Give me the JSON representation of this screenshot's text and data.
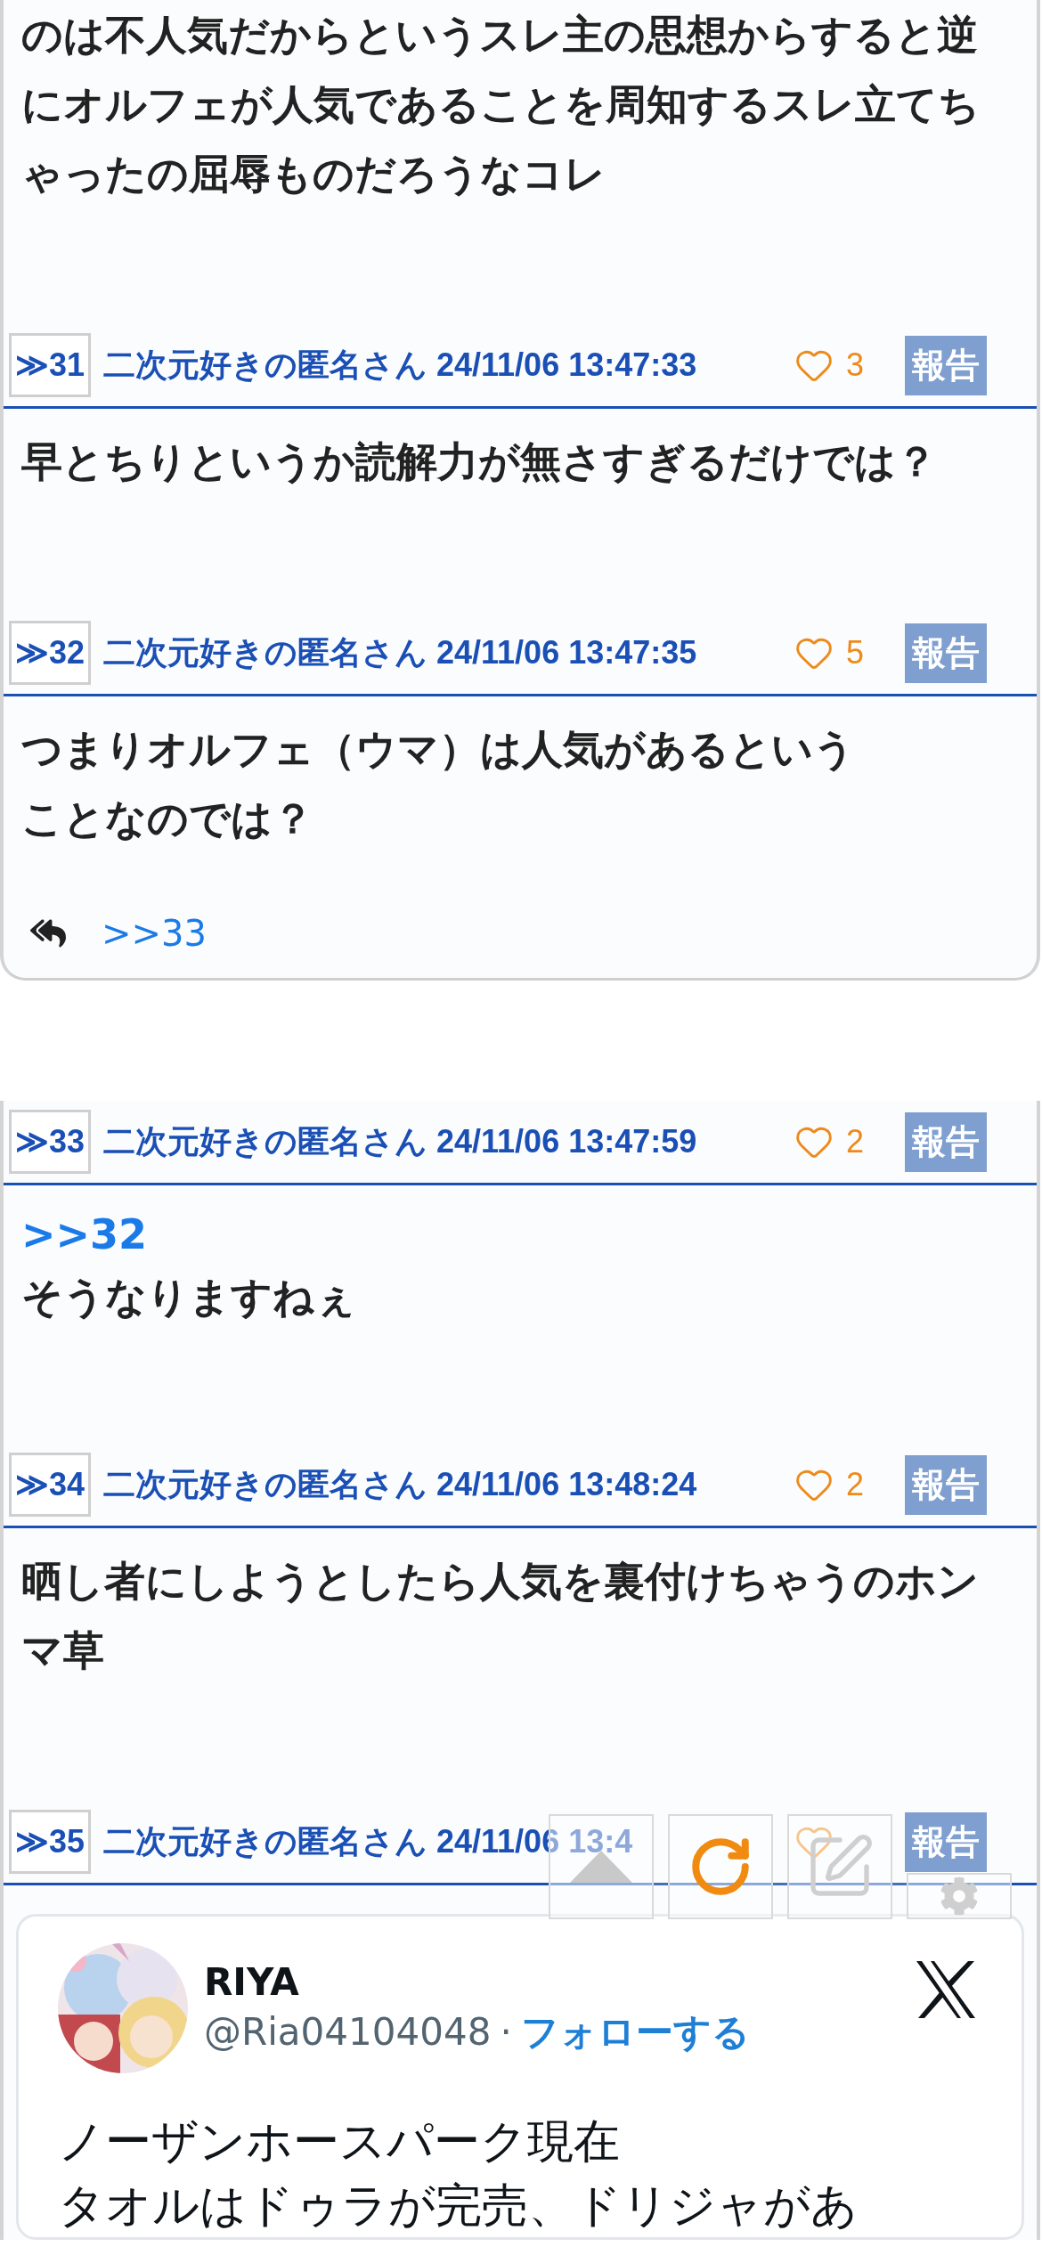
{
  "cards": [
    {
      "closed": true,
      "posts": [
        {
          "body": [
            "のは不人気だからというスレ主の思想からすると逆",
            "にオルフェが人気であることを周知するスレ立てち",
            "ゃったの屈辱ものだろうなコレ"
          ]
        },
        {
          "number": "≫31",
          "author": "二次元好きの匿名さん",
          "date": "24/11/06 13:47:33",
          "likes": "3",
          "report": "報告",
          "body": [
            "早とちりというか読解力が無さすぎるだけでは？"
          ]
        },
        {
          "number": "≫32",
          "author": "二次元好きの匿名さん",
          "date": "24/11/06 13:47:35",
          "likes": "5",
          "report": "報告",
          "body": [
            "つまりオルフェ（ウマ）は人気があるという",
            "ことなのでは？"
          ],
          "replies": [
            ">>33"
          ]
        }
      ]
    },
    {
      "closed": false,
      "posts": [
        {
          "number": "≫33",
          "author": "二次元好きの匿名さん",
          "date": "24/11/06 13:47:59",
          "likes": "2",
          "report": "報告",
          "anchor": ">>32",
          "body": [
            "そうなりますねぇ"
          ]
        },
        {
          "number": "≫34",
          "author": "二次元好きの匿名さん",
          "date": "24/11/06 13:48:24",
          "likes": "2",
          "report": "報告",
          "body": [
            "晒し者にしようとしたら人気を裏付けちゃうのホン",
            "マ草"
          ]
        },
        {
          "number": "≫35",
          "author": "二次元好きの匿名さん",
          "date": "24/11/06 13:4",
          "report": "報告",
          "embed": {
            "name": "RIYA",
            "handle": "@Ria04104048",
            "separator": "·",
            "follow": "フォローする",
            "text": [
              "ノーザンホースパーク現在",
              "タオルはドゥラが完売、ドリジャがあ"
            ]
          }
        }
      ]
    }
  ],
  "toolbar": [
    {
      "kind": "top"
    },
    {
      "kind": "reload"
    },
    {
      "kind": "edit"
    },
    {
      "kind": "settings"
    }
  ]
}
